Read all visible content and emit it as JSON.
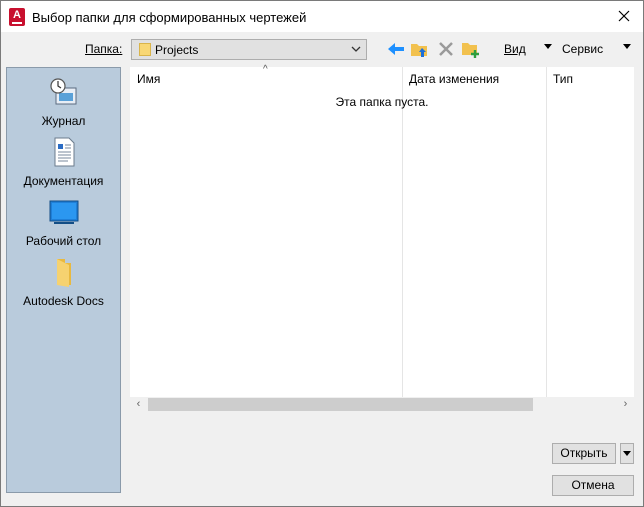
{
  "window": {
    "title": "Выбор папки для сформированных чертежей",
    "app_icon_letter": "A"
  },
  "toolbar": {
    "folder_label": "Папка:",
    "folder_value": "Projects",
    "view_label": "Вид",
    "tools_label": "Сервис"
  },
  "places": [
    {
      "label": "Журнал",
      "icon": "history-icon"
    },
    {
      "label": "Документация",
      "icon": "documents-icon"
    },
    {
      "label": "Рабочий стол",
      "icon": "desktop-icon"
    },
    {
      "label": "Autodesk Docs",
      "icon": "folder-icon"
    }
  ],
  "filelist": {
    "columns": [
      "Имя",
      "Дата изменения",
      "Тип"
    ],
    "empty_message": "Эта папка пуста."
  },
  "buttons": {
    "open": "Открыть",
    "cancel": "Отмена"
  },
  "colors": {
    "places_bg": "#b9cbdc",
    "accent_blue": "#1e90ff",
    "brand_red": "#c8102e"
  }
}
